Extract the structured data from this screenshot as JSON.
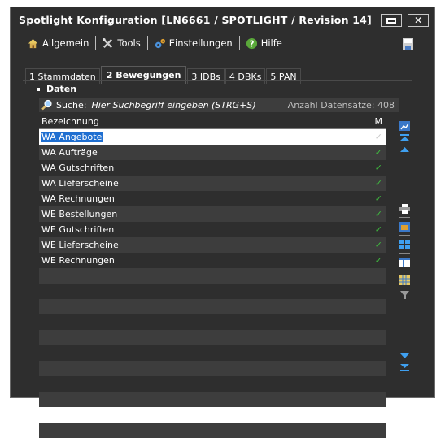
{
  "window": {
    "title": "Spotlight Konfiguration [LN6661 / SPOTLIGHT / Revision 14]"
  },
  "menu": {
    "items": [
      {
        "label": "Allgemein",
        "icon": "home-icon"
      },
      {
        "label": "Tools",
        "icon": "tools-icon"
      },
      {
        "label": "Einstellungen",
        "icon": "gears-icon"
      },
      {
        "label": "Hilfe",
        "icon": "help-icon"
      }
    ]
  },
  "tabs": [
    {
      "num": "1",
      "label": "Stammdaten",
      "active": false
    },
    {
      "num": "2",
      "label": "Bewegungen",
      "active": true
    },
    {
      "num": "3",
      "label": "IDBs",
      "active": false
    },
    {
      "num": "4",
      "label": "DBKs",
      "active": false
    },
    {
      "num": "5",
      "label": "PAN",
      "active": false
    }
  ],
  "section": {
    "title": "Daten"
  },
  "search": {
    "label": "Suche:",
    "placeholder": "Hier Suchbegriff eingeben (STRG+S)",
    "count_text": "Anzahl Datensätze: 408"
  },
  "grid": {
    "columns": [
      "Bezeichnung",
      "M"
    ],
    "rows": [
      {
        "name": "WA Angebote",
        "m": "✓"
      },
      {
        "name": "WA Aufträge",
        "m": "✓"
      },
      {
        "name": "WA Gutschriften",
        "m": "✓"
      },
      {
        "name": "WA Lieferscheine",
        "m": "✓"
      },
      {
        "name": "WA Rechnungen",
        "m": "✓"
      },
      {
        "name": "WE Bestellungen",
        "m": "✓"
      },
      {
        "name": "WE Gutschriften",
        "m": "✓"
      },
      {
        "name": "WE Lieferscheine",
        "m": "✓"
      },
      {
        "name": "WE Rechnungen",
        "m": "✓"
      }
    ]
  },
  "colors": {
    "background": "#2e2e2e",
    "alt_row": "#3d3d3d",
    "selection": "#1f6fd1",
    "check": "#3fbf3f"
  }
}
